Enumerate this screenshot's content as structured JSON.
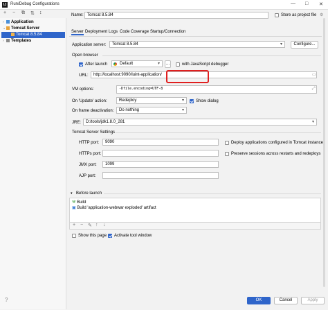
{
  "window": {
    "title": "Run/Debug Configurations",
    "logo": "IJ",
    "controls": [
      "—",
      "□",
      "✕"
    ]
  },
  "toolbar": {
    "icons": [
      "add-icon",
      "remove-icon",
      "copy-icon",
      "move-icon",
      "sort-icon"
    ],
    "glyphs": [
      "+",
      "−",
      "⧉",
      "⇅",
      "↕"
    ]
  },
  "tree": {
    "items": [
      {
        "label": "Application",
        "arrow": "›"
      },
      {
        "label": "Tomcat Server",
        "arrow": "⌄"
      },
      {
        "label": "Tomcat 8.5.84"
      },
      {
        "label": "Templates",
        "arrow": "›"
      }
    ]
  },
  "header": {
    "name_label": "Name:",
    "name_value": "Tomcat 8.5.84",
    "store_label": "Store as project file"
  },
  "tabs": [
    "Server",
    "Deployment",
    "Logs",
    "Code Coverage",
    "Startup/Connection"
  ],
  "server": {
    "app_server_label": "Application server:",
    "app_server_value": "Tomcat 8.5.84",
    "configure_label": "Configure...",
    "open_browser_label": "Open browser",
    "after_launch_label": "After launch",
    "browser_value": "Default",
    "more_label": "...",
    "js_debugger_label": "with JavaScript debugger",
    "url_label": "URL:",
    "url_value": "http://localhost:9090/luint-application/",
    "vm_label": "VM options:",
    "vm_value": "-Dfile.encoding=UTF-8",
    "on_update_label": "On 'Update' action:",
    "on_update_value": "Redeploy",
    "show_dialog_label": "Show dialog",
    "on_frame_label": "On frame deactivation:",
    "on_frame_value": "Do nothing",
    "jre_label": "JRE:",
    "jre_value": "D:/tools/jdk1.8.0_281",
    "tomcat_settings_label": "Tomcat Server Settings",
    "http_port_label": "HTTP port:",
    "http_port_value": "9090",
    "https_port_label": "HTTPs port:",
    "https_port_value": "",
    "jmx_port_label": "JMX port:",
    "jmx_port_value": "1099",
    "ajp_port_label": "AJP port:",
    "ajp_port_value": "",
    "deploy_apps_label": "Deploy applications configured in Tomcat instance",
    "preserve_label": "Preserve sessions across restarts and redeploys"
  },
  "before_launch": {
    "header": "Before launch",
    "items": [
      "Build",
      "Build 'application-webwar exploded' artifact"
    ],
    "tool_glyphs": [
      "+",
      "−",
      "✎",
      "↑",
      "↓"
    ]
  },
  "footer": {
    "show_page_label": "Show this page",
    "activate_tool_label": "Activate tool window",
    "ok_label": "OK",
    "cancel_label": "Cancel",
    "apply_label": "Apply"
  }
}
